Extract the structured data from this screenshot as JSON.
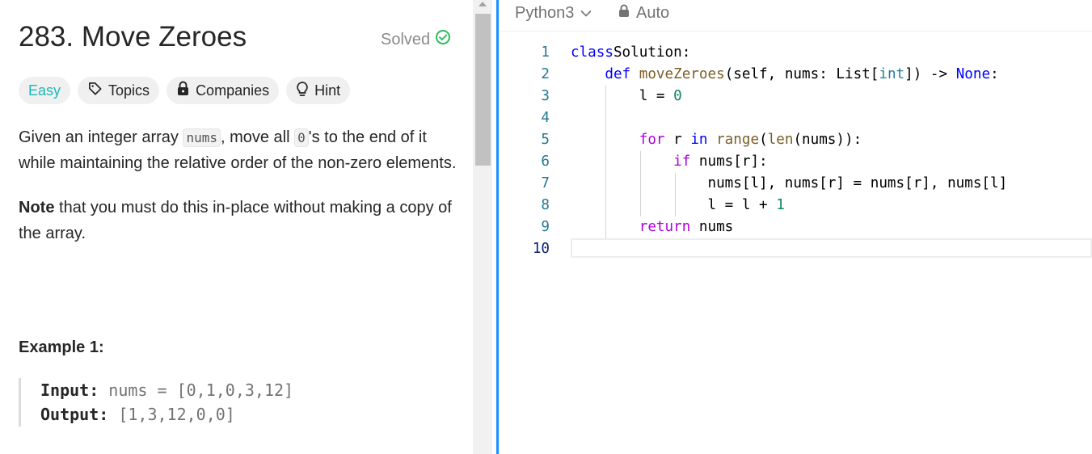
{
  "problem": {
    "title": "283. Move Zeroes",
    "status": "Solved",
    "tags": {
      "difficulty": "Easy",
      "topics": "Topics",
      "companies": "Companies",
      "hint": "Hint"
    },
    "description": {
      "p1_a": "Given an integer array ",
      "p1_code1": "nums",
      "p1_b": ", move all ",
      "p1_code2": "0",
      "p1_c": "'s to the end of it while maintaining the relative order of the non-zero elements.",
      "p2_bold": "Note",
      "p2_rest": " that you must do this in-place without making a copy of the array."
    },
    "example": {
      "title": "Example 1:",
      "input_label": "Input:",
      "input_value": " nums = [0,1,0,3,12]",
      "output_label": "Output:",
      "output_value": " [1,3,12,0,0]"
    }
  },
  "editor": {
    "language": "Python3",
    "mode": "Auto",
    "line_numbers": [
      "1",
      "2",
      "3",
      "4",
      "5",
      "6",
      "7",
      "8",
      "9",
      "10"
    ],
    "code": [
      [
        [
          "kw",
          "class"
        ],
        [
          "",
          "Solution"
        ],
        [
          "",
          ":"
        ]
      ],
      [
        [
          "",
          "    "
        ],
        [
          "kw",
          "def"
        ],
        [
          "",
          " "
        ],
        [
          "fn",
          "moveZeroes"
        ],
        [
          "",
          "(self, nums: List["
        ],
        [
          "cls",
          "int"
        ],
        [
          "",
          "]) -> "
        ],
        [
          "kw",
          "None"
        ],
        [
          "",
          ":"
        ]
      ],
      [
        [
          "",
          "        l = "
        ],
        [
          "num",
          "0"
        ]
      ],
      [],
      [
        [
          "",
          "        "
        ],
        [
          "fl",
          "for"
        ],
        [
          "",
          " r "
        ],
        [
          "kw",
          "in"
        ],
        [
          "",
          " "
        ],
        [
          "fn",
          "range"
        ],
        [
          "",
          "("
        ],
        [
          "fn",
          "len"
        ],
        [
          "",
          "(nums)):"
        ]
      ],
      [
        [
          "",
          "            "
        ],
        [
          "fl",
          "if"
        ],
        [
          "",
          " nums[r]:"
        ]
      ],
      [
        [
          "",
          "                nums[l], nums[r] = nums[r], nums[l]"
        ]
      ],
      [
        [
          "",
          "                l = l + "
        ],
        [
          "num",
          "1"
        ]
      ],
      [
        [
          "",
          "        "
        ],
        [
          "fl",
          "return"
        ],
        [
          "",
          " nums"
        ]
      ],
      []
    ]
  },
  "colors": {
    "accent": "#1a90ff",
    "easy": "#1cb8b8",
    "solved_check": "#2cbb5d"
  }
}
